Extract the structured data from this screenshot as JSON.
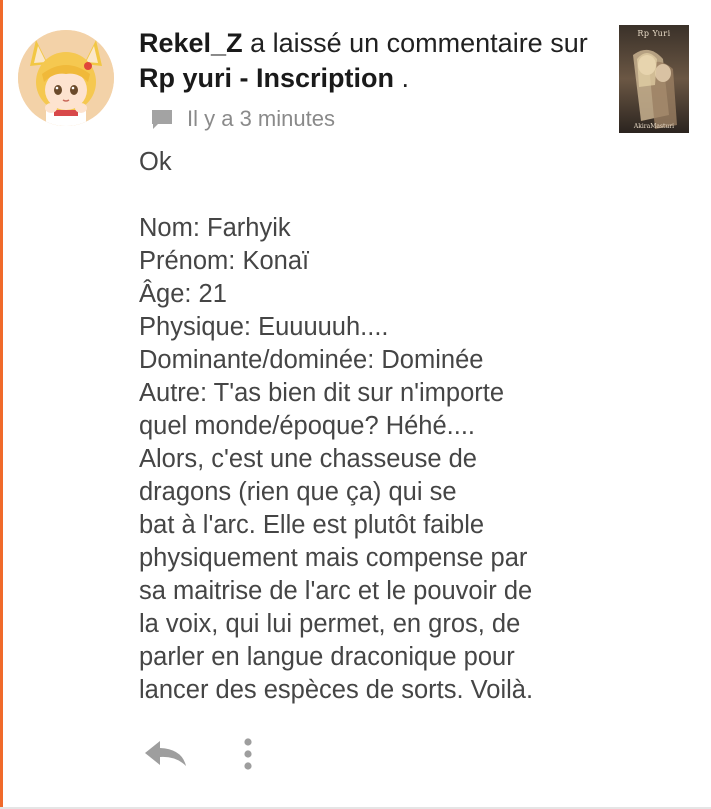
{
  "notification": {
    "user": "Rekel_Z",
    "action_text": " a laissé un commentaire sur ",
    "target": "Rp yuri - Inscription",
    "trailing": " .",
    "time": "Il y a 3 minutes",
    "thumbnail": {
      "title": "Rp Yuri",
      "author": "AkiraMasturi"
    }
  },
  "comment": {
    "lines": [
      "Ok",
      "",
      "Nom: Farhyik",
      "Prénom: Konaï",
      "Âge: 21",
      "Physique: Euuuuuh....",
      "Dominante/dominée: Dominée",
      "Autre: T'as bien dit sur n'importe",
      "quel monde/époque? Héhé....",
      "Alors, c'est une chasseuse de",
      "dragons (rien que ça) qui se",
      "bat à l'arc. Elle est plutôt faible",
      "physiquement mais compense par",
      "sa maitrise de l'arc et le pouvoir de",
      "la voix, qui lui permet, en gros, de",
      "parler en langue draconique pour",
      "lancer des espèces de sorts. Voilà."
    ]
  },
  "icons": {
    "comment": "comment-bubble-icon",
    "reply": "reply-arrow-icon",
    "more": "more-vertical-icon"
  },
  "colors": {
    "accent": "#f06a2a",
    "meta_text": "#8a8a8a",
    "body_text": "#454545",
    "icon_gray": "#9e9e9e"
  }
}
